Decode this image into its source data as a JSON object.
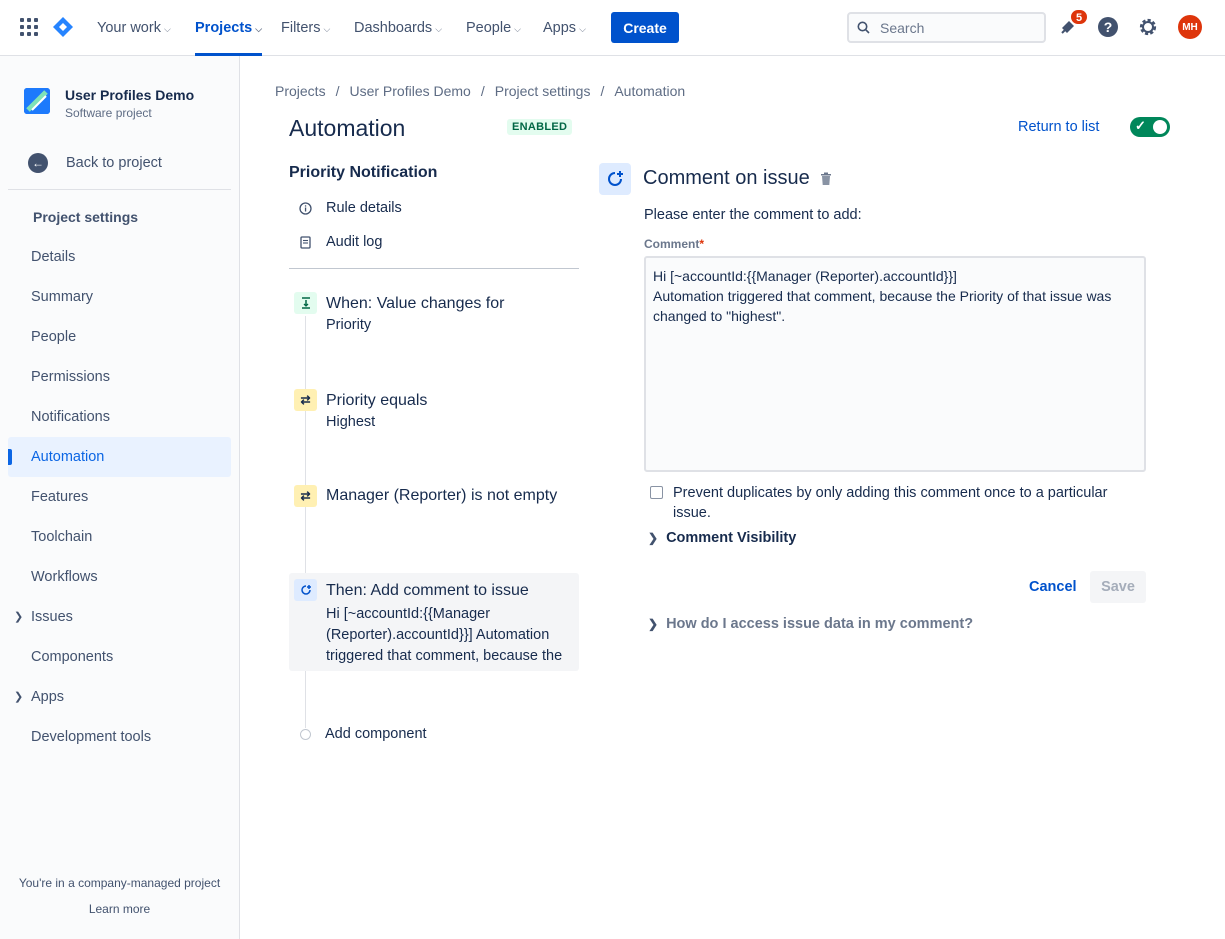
{
  "nav": {
    "items": [
      "Your work",
      "Projects",
      "Filters",
      "Dashboards",
      "People",
      "Apps"
    ],
    "active": "Projects",
    "create_label": "Create",
    "search_placeholder": "Search",
    "notification_count": "5",
    "avatar_initials": "MH"
  },
  "sidebar": {
    "project_name": "User Profiles Demo",
    "project_type": "Software project",
    "back_label": "Back to project",
    "heading": "Project settings",
    "items": [
      {
        "label": "Details"
      },
      {
        "label": "Summary"
      },
      {
        "label": "People"
      },
      {
        "label": "Permissions"
      },
      {
        "label": "Notifications"
      },
      {
        "label": "Automation"
      },
      {
        "label": "Features"
      },
      {
        "label": "Toolchain"
      },
      {
        "label": "Workflows"
      },
      {
        "label": "Issues"
      },
      {
        "label": "Components"
      },
      {
        "label": "Apps"
      },
      {
        "label": "Development tools"
      }
    ],
    "active_item": "Automation",
    "footer_text": "You're in a company-managed project",
    "footer_link": "Learn more"
  },
  "breadcrumb": [
    "Projects",
    "User Profiles Demo",
    "Project settings",
    "Automation"
  ],
  "page": {
    "title": "Automation",
    "status": "ENABLED",
    "return_label": "Return to list"
  },
  "rule": {
    "name": "Priority Notification",
    "links": [
      "Rule details",
      "Audit log"
    ],
    "steps": [
      {
        "title": "When: Value changes for",
        "sub": "Priority"
      },
      {
        "title": "Priority equals",
        "sub": "Highest"
      },
      {
        "title": "Manager (Reporter) is not empty",
        "sub": ""
      },
      {
        "title": "Then: Add comment to issue",
        "sub": "Hi [~accountId:{{Manager (Reporter).accountId}}] Automation triggered that comment, because the"
      }
    ],
    "add_component": "Add component"
  },
  "panel": {
    "title": "Comment on issue",
    "prompt": "Please enter the comment to add:",
    "field_label": "Comment",
    "required_mark": "*",
    "comment_value": "Hi [~accountId:{{Manager (Reporter).accountId}}]\nAutomation triggered that comment, because the Priority of that issue was changed to \"highest\".",
    "checkbox_label": "Prevent duplicates by only adding this comment once to a particular issue.",
    "visibility_label": "Comment Visibility",
    "cancel_label": "Cancel",
    "save_label": "Save",
    "help_label": "How do I access issue data in my comment?"
  },
  "colors": {
    "brand": "#0052CC",
    "enabled_bg": "#E3FCEF",
    "toggle_on": "#00875A",
    "badge": "#DE350B"
  }
}
